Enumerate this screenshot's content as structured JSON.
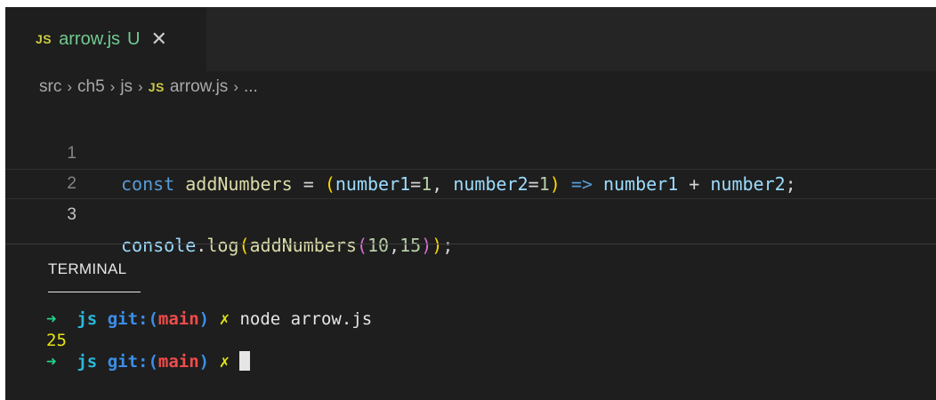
{
  "tab": {
    "badge": "JS",
    "filename": "arrow.js",
    "status": "U",
    "close": "✕"
  },
  "breadcrumb": {
    "lead": ".",
    "parts": [
      "src",
      "ch5",
      "js"
    ],
    "file_badge": "JS",
    "file": "arrow.js",
    "tail": "...",
    "separator": "›"
  },
  "editor": {
    "line_numbers": [
      "1",
      "2",
      "3"
    ],
    "line1": {
      "kw": "const",
      "name": "addNumbers",
      "eq": " = ",
      "open": "(",
      "p1": "number1",
      "eq1": "=",
      "v1": "1",
      "comma": ", ",
      "p2": "number2",
      "eq2": "=",
      "v2": "1",
      "close": ")",
      "arrow": " => ",
      "a": "number1",
      "plus": " + ",
      "b": "number2",
      "semi": ";"
    },
    "line3": {
      "obj": "console",
      "dot": ".",
      "method": "log",
      "open": "(",
      "call": "addNumbers",
      "open2": "(",
      "arg1": "10",
      "comma": ",",
      "arg2": "15",
      "close2": ")",
      "close": ")",
      "semi": ";"
    }
  },
  "panel": {
    "tab": "TERMINAL"
  },
  "terminal": {
    "prompt_arrow": "➜",
    "dir": "js",
    "git_label": "git:",
    "paren_open": "(",
    "branch": "main",
    "paren_close": ")",
    "dirty": "✗",
    "command": "node arrow.js",
    "output": "25"
  }
}
